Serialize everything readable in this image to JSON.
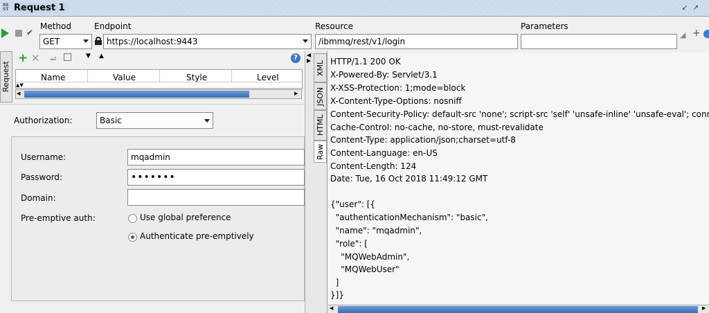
{
  "window": {
    "icon_text": "RE ST",
    "title": "Request 1"
  },
  "toolbar": {
    "method_label": "Method",
    "method_value": "GET",
    "endpoint_label": "Endpoint",
    "endpoint_value": "https://localhost:9443",
    "resource_label": "Resource",
    "resource_value": "/ibmmq/rest/v1/login",
    "parameters_label": "Parameters",
    "parameters_value": ""
  },
  "left_panel": {
    "tab_label": "Request",
    "headers_columns": [
      "Name",
      "Value",
      "Style",
      "Level"
    ]
  },
  "auth": {
    "authorization_label": "Authorization:",
    "authorization_value": "Basic",
    "username_label": "Username:",
    "username_value": "mqadmin",
    "password_label": "Password:",
    "password_value": "•••••••",
    "domain_label": "Domain:",
    "domain_value": "",
    "preemptive_label": "Pre-emptive auth:",
    "option_global": "Use global preference",
    "option_preemptive": "Authenticate pre-emptively",
    "selected_option": "Authenticate pre-emptively"
  },
  "response_tabs": [
    "XML",
    "JSON",
    "HTML",
    "Raw"
  ],
  "active_response_tab": "Raw",
  "response_lines": [
    "HTTP/1.1 200 OK",
    "X-Powered-By: Servlet/3.1",
    "X-XSS-Protection: 1;mode=block",
    "X-Content-Type-Options: nosniff",
    "Content-Security-Policy: default-src 'none'; script-src 'self' 'unsafe-inline' 'unsafe-eval'; connec",
    "Cache-Control: no-cache, no-store, must-revalidate",
    "Content-Type: application/json;charset=utf-8",
    "Content-Language: en-US",
    "Content-Length: 124",
    "Date: Tue, 16 Oct 2018 11:49:12 GMT",
    "",
    "{\"user\": [{",
    "  \"authenticationMechanism\": \"basic\",",
    "  \"name\": \"mqadmin\",",
    "  \"role\": [",
    "    \"MQWebAdmin\",",
    "    \"MQWebUser\"",
    "  ]",
    "}]}"
  ],
  "colors": {
    "accent": "#3b6fb3",
    "run_green": "#2e9b2e",
    "add_green": "#2aa02a",
    "delete_gray": "#9a9a9a"
  }
}
